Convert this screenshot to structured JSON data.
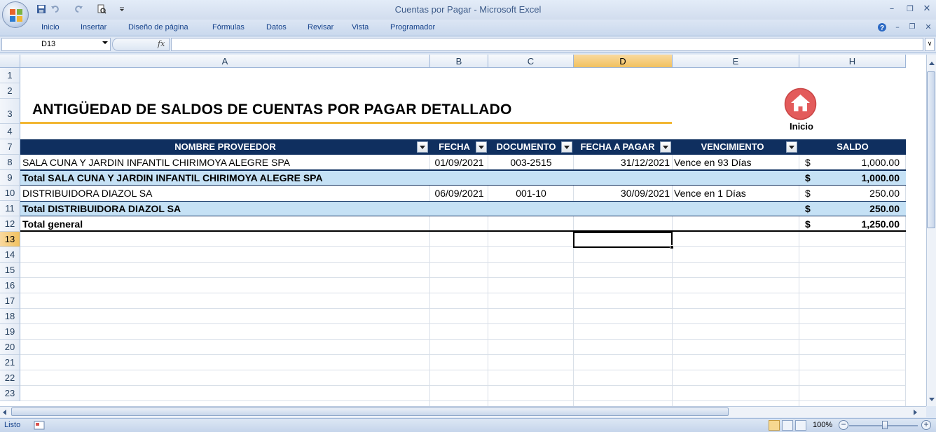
{
  "window": {
    "title": "Cuentas por Pagar - Microsoft Excel"
  },
  "ribbon": {
    "tabs": [
      "Inicio",
      "Insertar",
      "Diseño de página",
      "Fórmulas",
      "Datos",
      "Revisar",
      "Vista",
      "Programador"
    ]
  },
  "formula_bar": {
    "name_box": "D13",
    "fx_label": "fx",
    "formula": ""
  },
  "columns": [
    "A",
    "B",
    "C",
    "D",
    "E",
    "H"
  ],
  "selected_column": "D",
  "rows": [
    "1",
    "2",
    "3",
    "4",
    "7",
    "8",
    "9",
    "10",
    "11",
    "12",
    "13",
    "14",
    "15",
    "16",
    "17",
    "18",
    "19",
    "20",
    "21",
    "22",
    "23"
  ],
  "selected_row": "13",
  "sheet": {
    "title": "ANTIGÜEDAD DE SALDOS DE CUENTAS POR PAGAR DETALLADO",
    "home_button_label": "Inicio",
    "headers": {
      "proveedor": "NOMBRE PROVEEDOR",
      "fecha": "FECHA",
      "documento": "DOCUMENTO",
      "fecha_pagar": "FECHA A PAGAR",
      "vencimiento": "VENCIMIENTO",
      "saldo": "SALDO"
    },
    "table_rows": [
      {
        "proveedor": "SALA CUNA Y JARDIN INFANTIL CHIRIMOYA ALEGRE SPA",
        "fecha": "01/09/2021",
        "documento": "003-2515",
        "fecha_pagar": "31/12/2021",
        "vencimiento": "Vence en 93 Días",
        "currency": "$",
        "saldo": "1,000.00"
      },
      {
        "total_label": "Total SALA CUNA Y JARDIN INFANTIL CHIRIMOYA ALEGRE SPA",
        "currency": "$",
        "saldo": "1,000.00"
      },
      {
        "proveedor": "DISTRIBUIDORA DIAZOL SA",
        "fecha": "06/09/2021",
        "documento": "001-10",
        "fecha_pagar": "30/09/2021",
        "vencimiento": "Vence en 1 Días",
        "currency": "$",
        "saldo": "250.00"
      },
      {
        "total_label": "Total DISTRIBUIDORA DIAZOL SA",
        "currency": "$",
        "saldo": "250.00"
      },
      {
        "total_label": "Total general",
        "currency": "$",
        "saldo": "1,250.00"
      }
    ]
  },
  "status_bar": {
    "status": "Listo",
    "zoom": "100%"
  },
  "colors": {
    "header_bg": "#0f2f5f",
    "total_bg": "#c5e1f5",
    "accent_underline": "#f2b632",
    "home_icon": "#e35b5b"
  }
}
